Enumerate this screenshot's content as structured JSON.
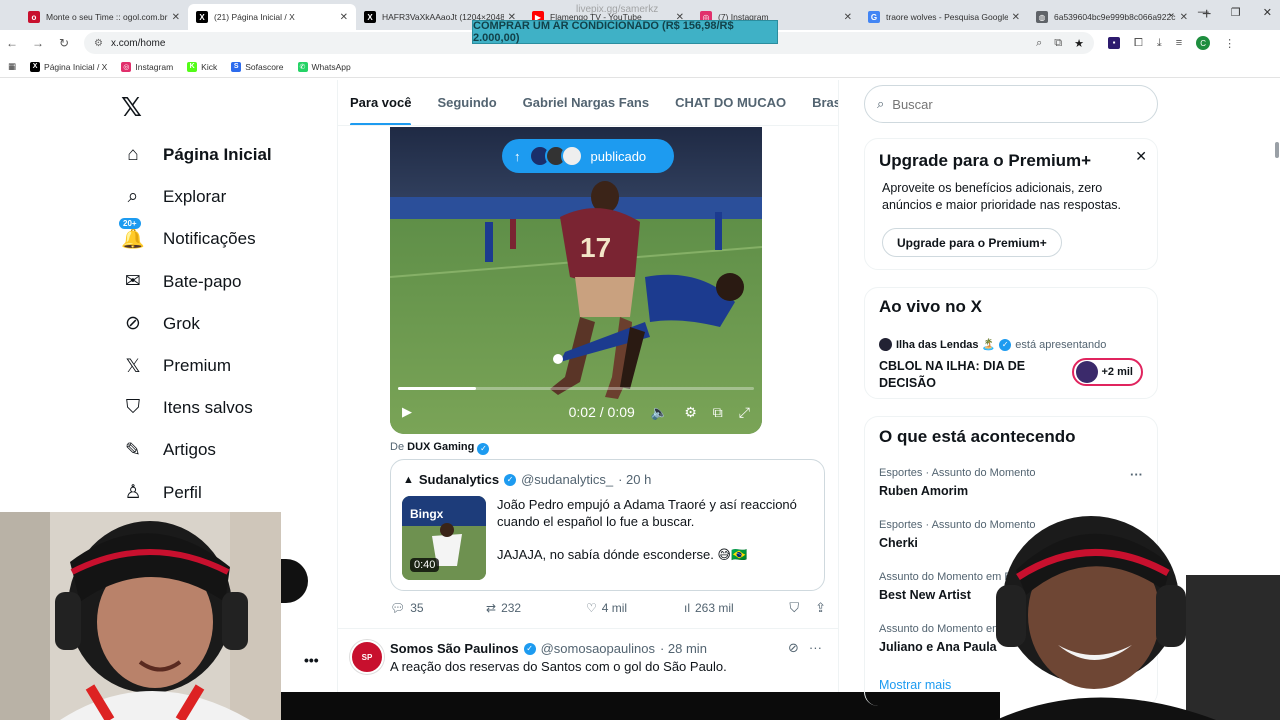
{
  "browser": {
    "tabs": [
      {
        "title": "Monte o seu Time :: ogol.com.br",
        "favicon_color": "#c8102e",
        "favicon_glyph": "o",
        "active": false
      },
      {
        "title": "(21) Página Inicial / X",
        "favicon_color": "#000000",
        "favicon_glyph": "X",
        "active": true
      },
      {
        "title": "HAFR3VaXkAAaoJt (1204×2048)",
        "favicon_color": "#000000",
        "favicon_glyph": "X",
        "active": false
      },
      {
        "title": "Flamengo TV - YouTube",
        "favicon_color": "#ff0000",
        "favicon_glyph": "▶",
        "active": false
      },
      {
        "title": "(7) Instagram",
        "favicon_color": "#e1306c",
        "favicon_glyph": "◎",
        "active": false
      },
      {
        "title": "traore wolves - Pesquisa Google",
        "favicon_color": "#4285f4",
        "favicon_glyph": "G",
        "active": false
      },
      {
        "title": "6a539604bc9e999b8c066a922c",
        "favicon_color": "#5f6368",
        "favicon_glyph": "◍",
        "active": false
      }
    ],
    "url": "x.com/home",
    "profile_initial": "C",
    "bookmarks": [
      {
        "label": "Página Inicial / X",
        "color": "#000000",
        "glyph": "X"
      },
      {
        "label": "Instagram",
        "color": "#e1306c",
        "glyph": "◎"
      },
      {
        "label": "Kick",
        "color": "#53fc18",
        "glyph": "K"
      },
      {
        "label": "Sofascore",
        "color": "#2c6bed",
        "glyph": "S"
      },
      {
        "label": "WhatsApp",
        "color": "#25d366",
        "glyph": "✆"
      }
    ]
  },
  "overlay": {
    "toast": "COMPRAR UM AR CONDICIONADO (R$ 156,98/R$ 2.000,00)",
    "watermark": "livepix.gg/samerkz"
  },
  "nav": {
    "items": [
      {
        "label": "Página Inicial",
        "icon": "home-icon",
        "glyph": "⌂",
        "active": true
      },
      {
        "label": "Explorar",
        "icon": "search-icon",
        "glyph": "⌕"
      },
      {
        "label": "Notificações",
        "icon": "bell-icon",
        "glyph": "🔔",
        "badge": "20+"
      },
      {
        "label": "Bate-papo",
        "icon": "mail-icon",
        "glyph": "✉"
      },
      {
        "label": "Grok",
        "icon": "grok-icon",
        "glyph": "⊘"
      },
      {
        "label": "Premium",
        "icon": "x-premium-icon",
        "glyph": "𝕏"
      },
      {
        "label": "Itens salvos",
        "icon": "bookmark-icon",
        "glyph": "⛉"
      },
      {
        "label": "Artigos",
        "icon": "article-icon",
        "glyph": "✎"
      },
      {
        "label": "Perfil",
        "icon": "profile-icon",
        "glyph": "♙"
      }
    ]
  },
  "timeline": {
    "tabs": [
      "Para você",
      "Seguindo",
      "Gabriel Nargas Fans",
      "CHAT DO MUCAO",
      "Brasileirão"
    ],
    "video": {
      "pill_label": "publicado",
      "time": "0:02 / 0:09",
      "progress": 0.22
    },
    "from_prefix": "De",
    "from_name": "DUX Gaming",
    "quote": {
      "name": "Sudanalytics",
      "handle": "@sudanalytics_",
      "time": "· 20 h",
      "duration": "0:40",
      "text1": "João Pedro empujó a Adama Traoré y así reaccionó cuando el español lo fue a buscar.",
      "text2": "JAJAJA, no sabía dónde esconderse. 😅🇧🇷"
    },
    "actions": {
      "replies": "35",
      "reposts": "232",
      "likes": "4 mil",
      "views": "263 mil"
    },
    "post2": {
      "name": "Somos São Paulinos",
      "handle": "@somosaopaulinos",
      "time": "· 28 min",
      "text": "A reação dos reservas do Santos com o gol do São Paulo."
    }
  },
  "sidebar": {
    "search_placeholder": "Buscar",
    "premium": {
      "title": "Upgrade para o Premium+",
      "desc": "Aproveite os benefícios adicionais, zero anúncios e maior prioridade nas respostas.",
      "button": "Upgrade para o Premium+"
    },
    "live": {
      "title": "Ao vivo no X",
      "host": "Ilha das Lendas 🏝️",
      "status": "está apresentando",
      "event": "CBLOL NA ILHA: DIA DE DECISÃO",
      "listeners": "+2 mil"
    },
    "trends": {
      "title": "O que está acontecendo",
      "items": [
        {
          "meta": "Esportes · Assunto do Momento",
          "name": "Ruben Amorim"
        },
        {
          "meta": "Esportes · Assunto do Momento",
          "name": "Cherki"
        },
        {
          "meta": "Assunto do Momento em Brasil",
          "name": "Best New Artist"
        },
        {
          "meta": "Assunto do Momento em Brasil",
          "name": "Juliano e Ana Paula"
        }
      ],
      "show_more": "Mostrar mais"
    }
  }
}
